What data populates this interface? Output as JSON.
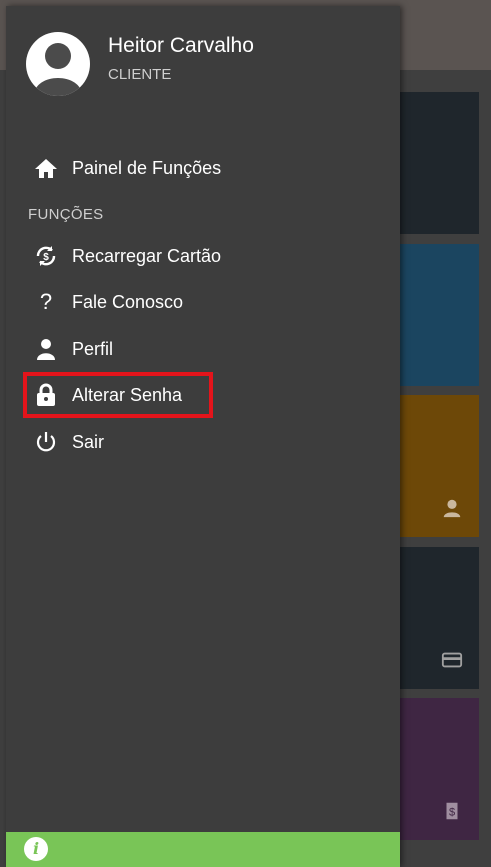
{
  "user": {
    "name": "Heitor Carvalho",
    "role": "CLIENTE"
  },
  "nav": {
    "dashboard": "Painel de Funções",
    "section_title": "FUNÇÕES",
    "items": [
      {
        "label": "Recarregar Cartão",
        "icon": "recharge-icon"
      },
      {
        "label": "Fale Conosco",
        "icon": "question-icon"
      },
      {
        "label": "Perfil",
        "icon": "user-icon"
      },
      {
        "label": "Alterar Senha",
        "icon": "lock-icon"
      },
      {
        "label": "Sair",
        "icon": "power-icon"
      }
    ]
  },
  "footer": {
    "info_icon": "i"
  },
  "colors": {
    "drawer": "#3d3d3d",
    "highlight": "#e4141b",
    "footer": "#79c557",
    "tile_dark": "#1f262c",
    "tile_blue": "#1b4560",
    "tile_orange": "#6d4808",
    "tile_purple": "#3f2643"
  },
  "background_tiles": [
    {
      "color": "#1f262c",
      "icon": ""
    },
    {
      "color": "#1b4560",
      "icon": ""
    },
    {
      "color": "#6d4808",
      "icon": "user-icon"
    },
    {
      "color": "#1f262c",
      "icon": "card-icon"
    },
    {
      "color": "#3f2643",
      "icon": "recharge-icon"
    }
  ]
}
